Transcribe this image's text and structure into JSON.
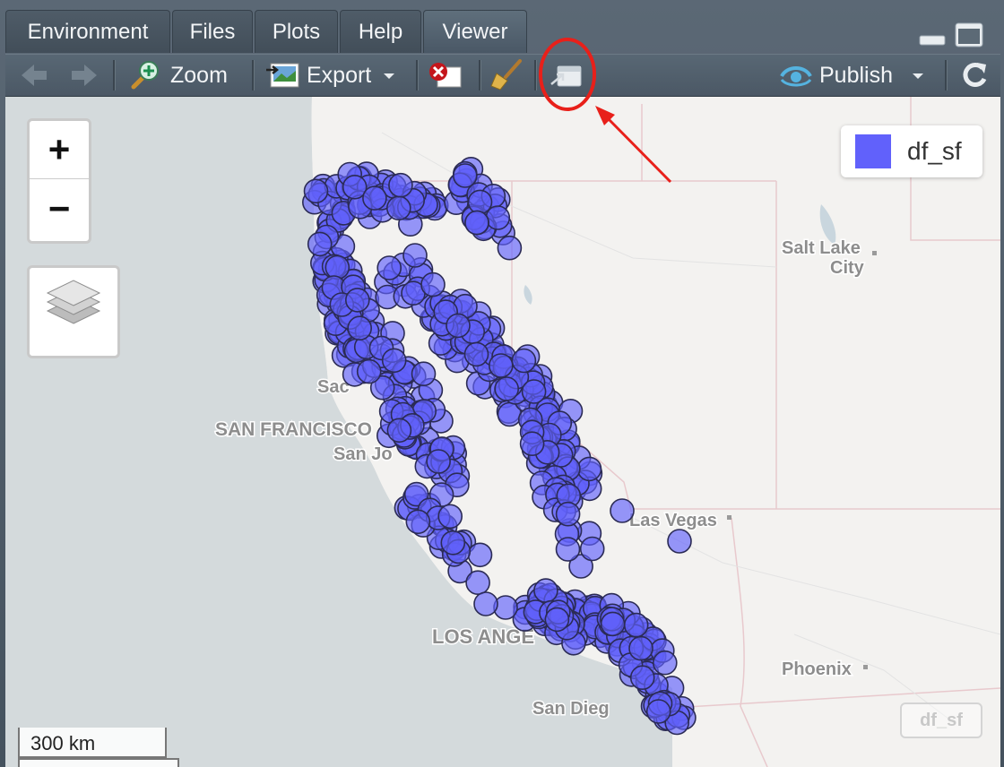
{
  "tabs": [
    "Environment",
    "Files",
    "Plots",
    "Help",
    "Viewer"
  ],
  "active_tab": "Viewer",
  "toolbar": {
    "zoom_label": "Zoom",
    "export_label": "Export",
    "publish_label": "Publish"
  },
  "map": {
    "zoom_in": "+",
    "zoom_out": "−",
    "legend_label": "df_sf",
    "layer_label": "df_sf",
    "scale_label": "300 km",
    "point_color": "#6161fb",
    "cities": {
      "salt_lake_city_1": "Salt Lake",
      "salt_lake_city_2": "City",
      "sacramento": "Sac",
      "san_francisco": "SAN FRANCISCO",
      "san_jose": "San Jo",
      "las_vegas": "Las Vegas",
      "los_angeles": "LOS ANGE",
      "phoenix": "Phoenix",
      "san_diego": "San Dieg"
    }
  },
  "annotation_color": "#e8201a"
}
